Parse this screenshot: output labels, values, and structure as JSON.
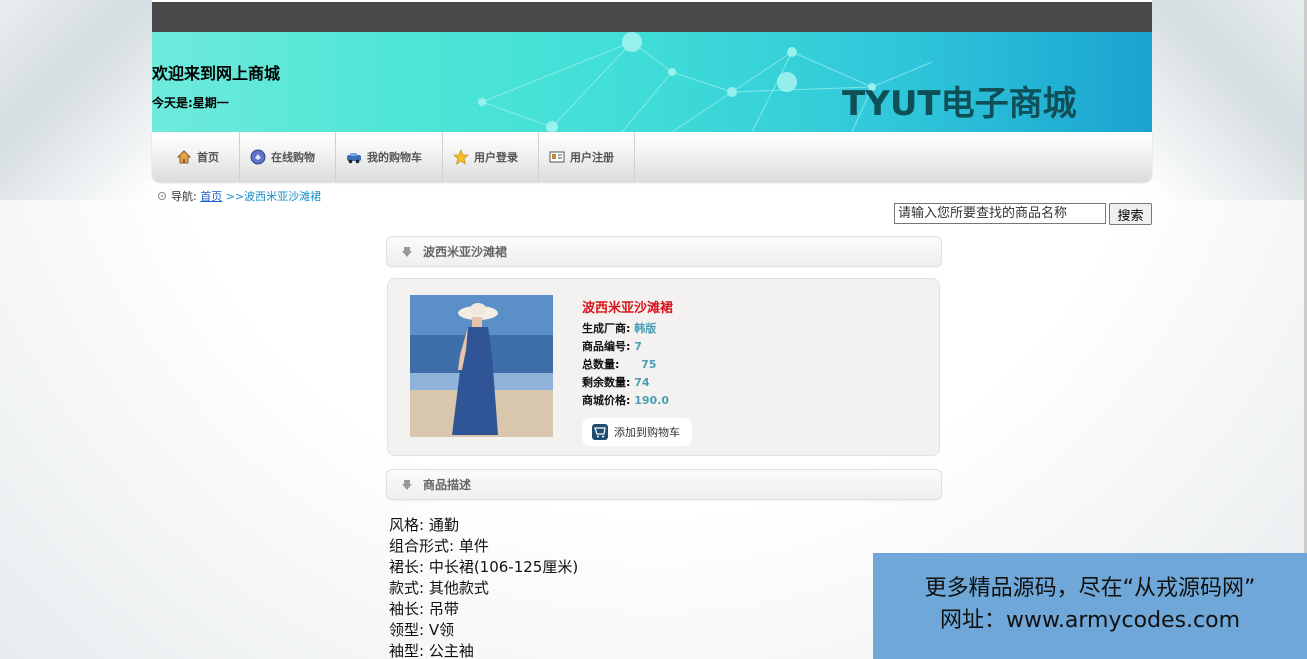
{
  "header": {
    "welcome": "欢迎来到网上商城",
    "weekday": "今天是:星期一",
    "brand": "TYUT电子商城"
  },
  "nav": {
    "items": [
      {
        "label": "首页",
        "icon": "home-icon"
      },
      {
        "label": "在线购物",
        "icon": "shopping-icon"
      },
      {
        "label": "我的购物车",
        "icon": "car-icon"
      },
      {
        "label": "用户登录",
        "icon": "star-icon"
      },
      {
        "label": "用户注册",
        "icon": "register-icon"
      }
    ]
  },
  "breadcrumb": {
    "prefix": "导航:",
    "home": "首页",
    "current": ">>波西米亚沙滩裙"
  },
  "search": {
    "placeholder": "请输入您所要查找的商品名称",
    "button": "搜索"
  },
  "product": {
    "panel_title": "波西米亚沙滩裙",
    "name": "波西米亚沙滩裙",
    "fields": [
      {
        "label": "生成厂商:",
        "value": "韩版"
      },
      {
        "label": "商品编号:",
        "value": "7"
      },
      {
        "label": "总数量:",
        "value": "75"
      },
      {
        "label": "剩余数量:",
        "value": "74"
      },
      {
        "label": "商城价格:",
        "value": "190.0"
      }
    ],
    "add_to_cart": "添加到购物车"
  },
  "description": {
    "panel_title": "商品描述",
    "lines": [
      "风格: 通勤",
      "组合形式: 单件",
      "裙长: 中长裙(106-125厘米)",
      "款式: 其他款式",
      "袖长: 吊带",
      "领型: V领",
      "袖型: 公主袖"
    ]
  },
  "ad": {
    "line1": "更多精品源码，尽在“从戎源码网”",
    "line2": "网址：www.armycodes.com"
  },
  "colors": {
    "topbar": "#4a4a4a",
    "brand": "#0f4f58",
    "product_title": "#d8151c",
    "value": "#4b9fb4",
    "ad_bg": "#6ea7d8"
  }
}
